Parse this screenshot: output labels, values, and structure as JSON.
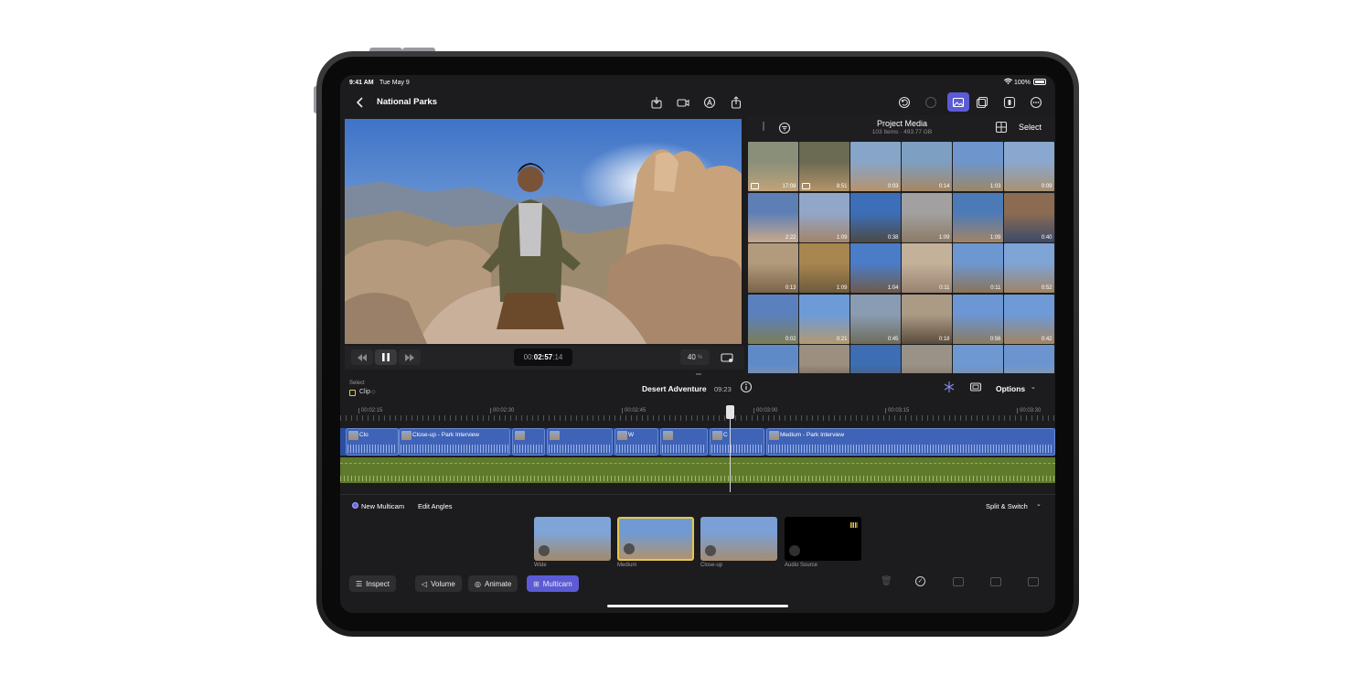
{
  "status_bar": {
    "time": "9:41 AM",
    "date": "Tue May 9",
    "battery": "100%"
  },
  "nav": {
    "back_icon": "chevron-left-icon",
    "title": "National Parks"
  },
  "viewer": {
    "rewind_icon": "rewind-icon",
    "pause_icon": "pause-icon",
    "forward_icon": "fast-forward-icon",
    "timecode_prefix": "00:",
    "timecode_main": "02:57",
    "timecode_frames": ":14",
    "zoom": "40",
    "zoom_unit": "%"
  },
  "browser": {
    "title": "Project Media",
    "subtitle": "103 Items  ·  493.77 GB",
    "select_label": "Select",
    "thumbnails": [
      {
        "dur": "17:08",
        "mc": true,
        "c1": "#8a8f7a",
        "c2": "#c0a37a"
      },
      {
        "dur": "8:51",
        "mc": true,
        "c1": "#6b6a52",
        "c2": "#b39469"
      },
      {
        "dur": "0:03",
        "mc": false,
        "c1": "#87a5c9",
        "c2": "#b6936c"
      },
      {
        "dur": "0:14",
        "mc": false,
        "c1": "#7d9fc2",
        "c2": "#a78662"
      },
      {
        "dur": "1:03",
        "mc": false,
        "c1": "#6e96cc",
        "c2": "#9b8767"
      },
      {
        "dur": "0:09",
        "mc": false,
        "c1": "#8aa8cf",
        "c2": "#a89272"
      },
      {
        "dur": "2:22",
        "mc": false,
        "c1": "#5e7fb6",
        "c2": "#c9a98a"
      },
      {
        "dur": "1:09",
        "mc": false,
        "c1": "#92a7c8",
        "c2": "#a38468"
      },
      {
        "dur": "0:38",
        "mc": false,
        "c1": "#3c6fb8",
        "c2": "#4c4a45"
      },
      {
        "dur": "1:09",
        "mc": false,
        "c1": "#a2a0a0",
        "c2": "#8d7a64"
      },
      {
        "dur": "1:09",
        "mc": false,
        "c1": "#4c7ab7",
        "c2": "#a28466"
      },
      {
        "dur": "0:40",
        "mc": false,
        "c1": "#8b6c52",
        "c2": "#3c4a6b"
      },
      {
        "dur": "0:13",
        "mc": false,
        "c1": "#b29a7c",
        "c2": "#7b644a"
      },
      {
        "dur": "1:09",
        "mc": false,
        "c1": "#a8864f",
        "c2": "#6d5a3e"
      },
      {
        "dur": "1:04",
        "mc": false,
        "c1": "#4b7cc8",
        "c2": "#6e5b4a"
      },
      {
        "dur": "0:11",
        "mc": false,
        "c1": "#c4b19a",
        "c2": "#978270"
      },
      {
        "dur": "0:11",
        "mc": false,
        "c1": "#6d97d1",
        "c2": "#8b7357"
      },
      {
        "dur": "0:52",
        "mc": false,
        "c1": "#7fa4d6",
        "c2": "#a08464"
      },
      {
        "dur": "0:02",
        "mc": false,
        "c1": "#5a81bd",
        "c2": "#7d7d56"
      },
      {
        "dur": "0:21",
        "mc": false,
        "c1": "#6d9bd8",
        "c2": "#b59a6e"
      },
      {
        "dur": "0:45",
        "mc": false,
        "c1": "#8a9cb4",
        "c2": "#6e6b5a"
      },
      {
        "dur": "0:18",
        "mc": false,
        "c1": "#ab9b85",
        "c2": "#5b4b3b"
      },
      {
        "dur": "0:56",
        "mc": false,
        "c1": "#6c96d4",
        "c2": "#8a7b5e"
      },
      {
        "dur": "0:42",
        "mc": false,
        "c1": "#6e9ad6",
        "c2": "#a38560"
      },
      {
        "dur": "",
        "mc": false,
        "c1": "#5f8ac8",
        "c2": "#b09a7a"
      },
      {
        "dur": "",
        "mc": false,
        "c1": "#9c8f80",
        "c2": "#473a31"
      },
      {
        "dur": "",
        "mc": false,
        "c1": "#3d6db2",
        "c2": "#5f5040"
      },
      {
        "dur": "",
        "mc": false,
        "c1": "#9a9286",
        "c2": "#6c5a48"
      },
      {
        "dur": "",
        "mc": false,
        "c1": "#6e98d2",
        "c2": "#93816a"
      },
      {
        "dur": "",
        "mc": false,
        "c1": "#6c95cf",
        "c2": "#b69a70"
      }
    ]
  },
  "timeline": {
    "select_label": "Select",
    "clip_label": "Clip",
    "project_title": "Desert Adventure",
    "project_duration": "09:23",
    "options_label": "Options",
    "ruler_ticks": [
      "00:02:15",
      "00:02:30",
      "00:02:45",
      "00:03:00",
      "00:03:15",
      "00:03:30"
    ],
    "clips": [
      {
        "label": "Clo"
      },
      {
        "label": "Close-up - Park Interview"
      },
      {
        "label": ""
      },
      {
        "label": ""
      },
      {
        "label": "W"
      },
      {
        "label": ""
      },
      {
        "label": "C"
      },
      {
        "label": "Medium - Park Interview"
      }
    ]
  },
  "multicam": {
    "new_label": "New Multicam",
    "edit_label": "Edit Angles",
    "mode_label": "Split & Switch",
    "angles": [
      {
        "label": "Wide",
        "c1": "#7fa5d8",
        "c2": "#a2896a",
        "selected": false
      },
      {
        "label": "Medium",
        "c1": "#6f9ad4",
        "c2": "#b09270",
        "selected": true
      },
      {
        "label": "Close-up",
        "c1": "#7aa0d6",
        "c2": "#a58d73",
        "selected": false
      },
      {
        "label": "Audio Source",
        "c1": "#000000",
        "c2": "#000000",
        "selected": false
      }
    ]
  },
  "toolbar": {
    "inspect": "Inspect",
    "volume": "Volume",
    "animate": "Animate",
    "multicam": "Multicam"
  },
  "colors": {
    "accent": "#5b5bd6",
    "clip_blue": "#3f63b6",
    "audio_green": "#5e7a2a",
    "selected_yellow": "#e6c84a"
  }
}
